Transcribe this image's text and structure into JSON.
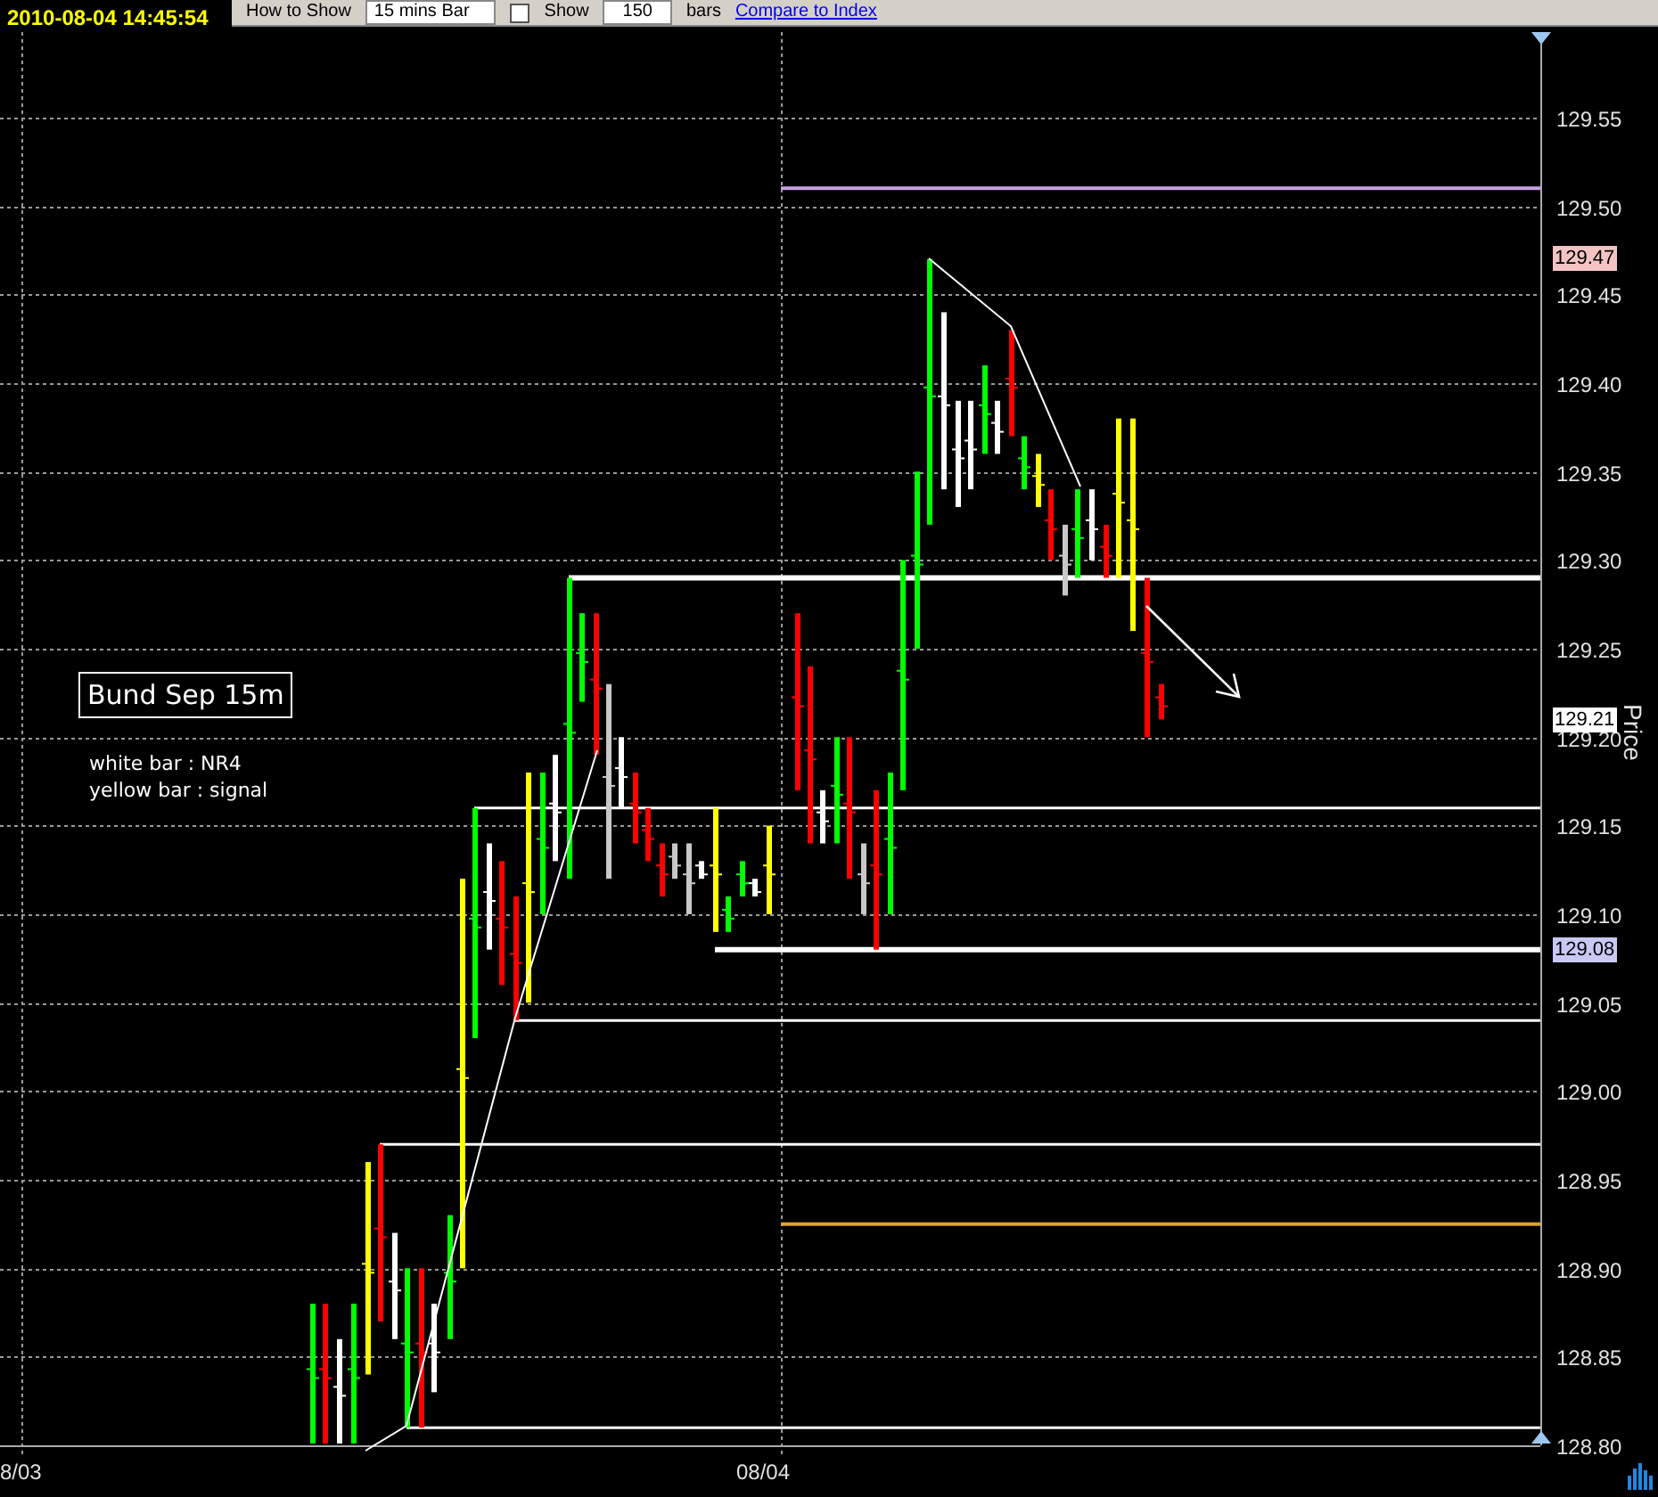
{
  "header": {
    "timestamp": "2010-08-04 14:45:54",
    "toolbar": {
      "show_label": "How to Show",
      "interval": "15 mins Bar",
      "show_checkbox": {
        "label": "Show",
        "checked": false
      },
      "bar_count": "150",
      "bars_label": "bars",
      "compare_link": "Compare to Index"
    }
  },
  "chart": {
    "title": "Bund Sep 15m",
    "legend": [
      "white bar : NR4",
      "yellow bar : signal"
    ],
    "price_axis": {
      "label": "Price",
      "ticks": [
        "129.55",
        "129.50",
        "129.45",
        "129.40",
        "129.35",
        "129.30",
        "129.25",
        "129.20",
        "129.15",
        "129.10",
        "129.05",
        "129.00",
        "128.95",
        "128.90",
        "128.85",
        "128.80"
      ]
    },
    "price_markers": [
      {
        "value": "129.47",
        "color": "#f4c4c4"
      },
      {
        "value": "129.21",
        "color": "#ffffff"
      },
      {
        "value": "129.08",
        "color": "#c8c8f4"
      }
    ],
    "time_axis": {
      "labels": [
        "8/03",
        "08/04"
      ]
    }
  }
}
